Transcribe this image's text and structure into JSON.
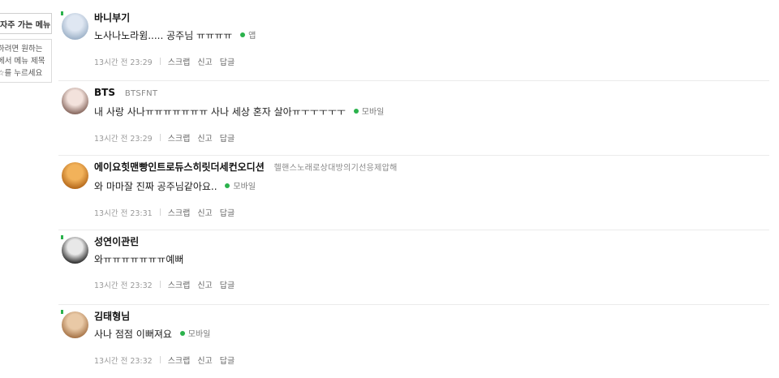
{
  "sidebar": {
    "title": "자주 가는 메뉴",
    "help_lines": [
      "하려면 원하는",
      "에서 메뉴 제목",
      "☆를 누르세요"
    ]
  },
  "actions": {
    "scrap": "스크랩",
    "report": "신고",
    "reply": "답글"
  },
  "comments": [
    {
      "nickname": "바니부기",
      "nickname_sub": "",
      "text": "노사나노라윔..... 공주님 ㅠㅠㅠㅠ",
      "device": "앱",
      "date": "13시간 전 23:29",
      "avatar_colors": [
        "#dfe7f2",
        "#9fb3c9"
      ]
    },
    {
      "nickname": "BTS",
      "nickname_sub": "BTSFNT",
      "text": "내 사랑 사나ㅠㅠㅠㅠㅠㅠㅠ 사나 세상 혼자 살아ㅠㅜㅜㅜㅜㅜ",
      "device": "모바일",
      "date": "13시간 전 23:29",
      "avatar_colors": [
        "#f3e2dc",
        "#8a6b62"
      ]
    },
    {
      "nickname": "에이요힛맨빵인트로듀스히릿더세컨오디션",
      "nickname_sub": "헬핸스노래로상대방의기선응제압해",
      "text": "와 마마잘 진짜 공주님같아요..",
      "device": "모바일",
      "date": "13시간 전 23:31",
      "avatar_colors": [
        "#f2b25a",
        "#b76b1c"
      ]
    },
    {
      "nickname": "성연이관린",
      "nickname_sub": "",
      "text": "와ㅠㅠㅠㅠㅠㅠㅠ예뻐",
      "device": "",
      "date": "13시간 전 23:32",
      "avatar_colors": [
        "#e8e8e8",
        "#333333"
      ]
    },
    {
      "nickname": "김태형님",
      "nickname_sub": "",
      "text": "사나 점점 이뻐져요",
      "device": "모바일",
      "date": "13시간 전 23:32",
      "avatar_colors": [
        "#e9c9a6",
        "#a8764a"
      ]
    }
  ],
  "colors": {
    "online": "#2bb24c",
    "divider": "#ebebeb"
  }
}
